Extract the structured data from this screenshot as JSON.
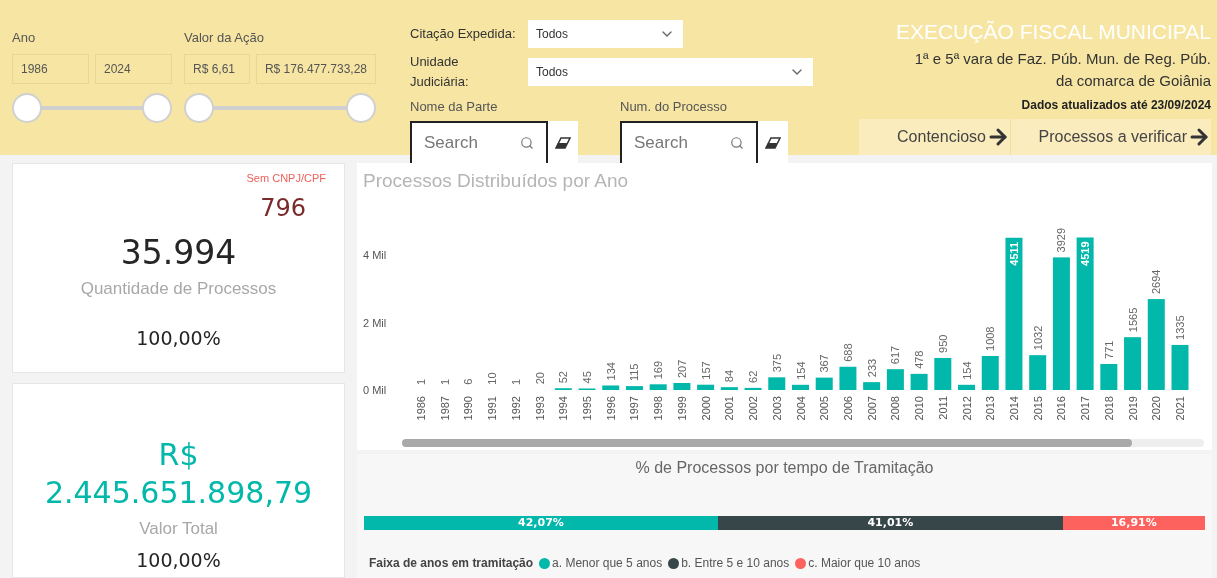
{
  "filters": {
    "ano": {
      "label": "Ano",
      "min": "1986",
      "max": "2024",
      "thumbs": [
        {
          "level": 0
        },
        {
          "level": 1
        }
      ]
    },
    "valor": {
      "label": "Valor da Ação",
      "min": "R$ 6,61",
      "max": "R$ 176.477.733,28",
      "thumbs": [
        {
          "level": 0
        },
        {
          "level": 1
        }
      ]
    },
    "dropdowns": [
      {
        "label": "Citação Expedida:",
        "value": "Todos"
      },
      {
        "label": "Unidade Judiciária:",
        "value": "Todos"
      }
    ],
    "searches": [
      {
        "label": "Nome da Parte",
        "placeholder": "Search"
      },
      {
        "label": "Num. do Processo",
        "placeholder": "Search"
      }
    ]
  },
  "header": {
    "title": "EXECUÇÃO FISCAL MUNICIPAL",
    "subtitle_lines": [
      "1ª e 5ª vara de Faz. Púb. Mun. de Reg. Púb.",
      "da comarca de Goiânia"
    ],
    "updated": "Dados atualizados até 23/09/2024",
    "nav_buttons": [
      "Contencioso",
      "Processos a verificar"
    ]
  },
  "cards": [
    {
      "corner_label": "Sem CNPJ/CPF",
      "corner_value": "796",
      "value_lines": [
        "35.994"
      ],
      "caption": "Quantidade de Processos",
      "percent": "100,00%"
    },
    {
      "value_lines": [
        "R$",
        "2.445.651.898,79"
      ],
      "caption": "Valor Total",
      "percent": "100,00%"
    }
  ],
  "chart": {
    "chart_data": {
      "type": "bar",
      "title": "Processos Distribuídos por Ano",
      "categories": [
        "1986",
        "1987",
        "1990",
        "1991",
        "1992",
        "1993",
        "1994",
        "1995",
        "1996",
        "1997",
        "1998",
        "1999",
        "2000",
        "2001",
        "2002",
        "2003",
        "2004",
        "2005",
        "2006",
        "2007",
        "2008",
        "2010",
        "2011",
        "2012",
        "2013",
        "2014",
        "2015",
        "2016",
        "2017",
        "2018",
        "2019",
        "2020",
        "2021"
      ],
      "values": [
        1,
        1,
        6,
        10,
        1,
        20,
        52,
        45,
        134,
        115,
        169,
        207,
        157,
        84,
        62,
        375,
        154,
        367,
        688,
        233,
        617,
        478,
        950,
        154,
        1008,
        4511,
        1032,
        3929,
        4519,
        771,
        1565,
        2694,
        1335
      ],
      "data_labels": true
    },
    "y_axis_labels": [
      "4 Mil",
      "2 Mil",
      "0 Mil"
    ]
  },
  "tramitacao": {
    "title": "% de Processos por tempo de Tramitação",
    "legend_title": "Faixa de anos em tramitação",
    "segments": [
      {
        "label": "42,07%",
        "color": "#01b8aa",
        "name": "a. Menor que 5 anos"
      },
      {
        "label": "41,01%",
        "color": "#374649",
        "name": "b. Entre 5 e 10 anos"
      },
      {
        "label": "16,91%",
        "color": "#fd625e",
        "name": "c. Maior que 10 anos"
      }
    ]
  }
}
